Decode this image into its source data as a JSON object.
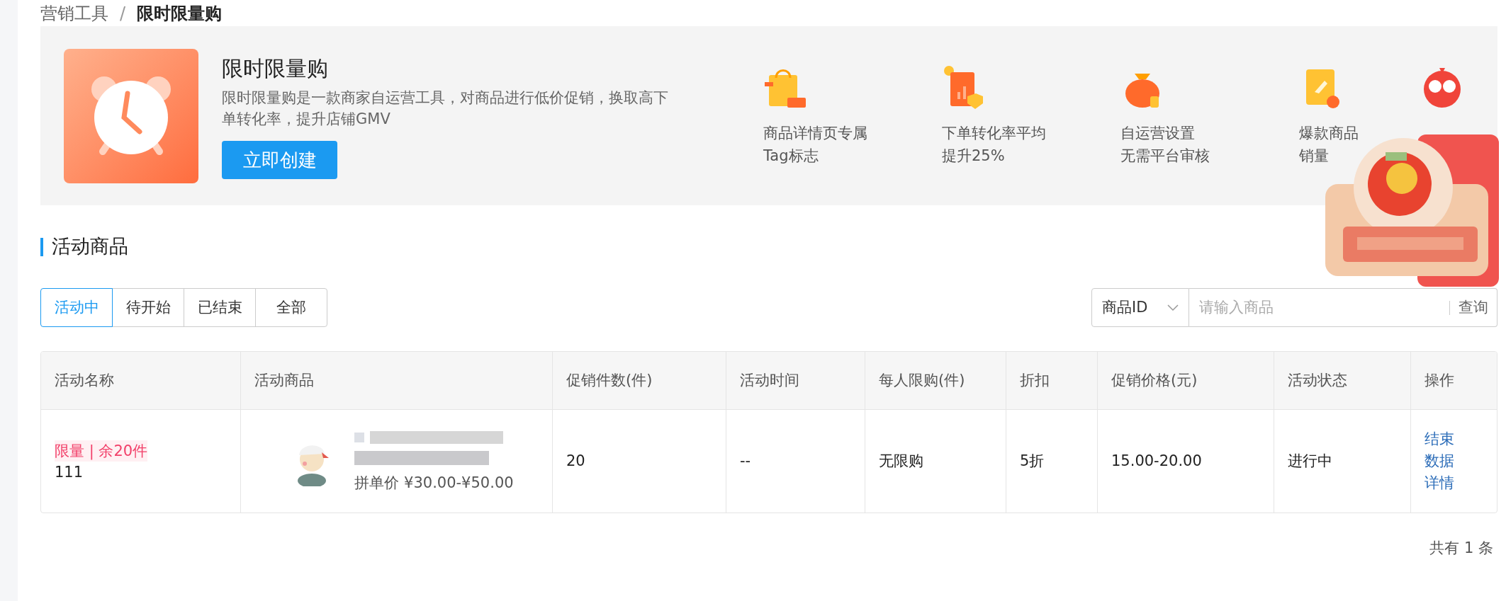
{
  "breadcrumb": {
    "items": [
      {
        "label": "营销工具",
        "current": false
      },
      {
        "label": "限时限量购",
        "current": true
      }
    ],
    "separator": "/"
  },
  "banner": {
    "title": "限时限量购",
    "description": "限时限量购是一款商家自运营工具，对商品进行低价促销，换取高下单转化率，提升店铺GMV",
    "button": "立即创建",
    "features": [
      {
        "kind": "bag",
        "lines": [
          "商品详情页专属",
          "Tag标志"
        ]
      },
      {
        "kind": "chart",
        "lines": [
          "下单转化率平均",
          "提升25%"
        ]
      },
      {
        "kind": "moneybag",
        "lines": [
          "自运营设置",
          "无需平台审核"
        ]
      },
      {
        "kind": "scroll",
        "lines": [
          "爆款商品",
          "销量"
        ]
      },
      {
        "kind": "mascot"
      }
    ]
  },
  "section_title": "活动商品",
  "tabs": [
    {
      "label": "活动中",
      "selected": true
    },
    {
      "label": "待开始",
      "selected": false
    },
    {
      "label": "已结束",
      "selected": false
    },
    {
      "label": "全部",
      "selected": false
    }
  ],
  "search": {
    "field": "商品ID",
    "placeholder": "请输入商品",
    "button": "查询"
  },
  "table": {
    "columns": [
      "活动名称",
      "活动商品",
      "促销件数(件)",
      "活动时间",
      "每人限购(件)",
      "折扣",
      "促销价格(元)",
      "活动状态",
      "操作"
    ],
    "rows": [
      {
        "tag": "限量 | 余20件",
        "name": "111",
        "product_price": "拼单价 ¥30.00-¥50.00",
        "quantity": "20",
        "time": "--",
        "limit": "无限购",
        "discount": "5折",
        "price": "15.00-20.00",
        "status": "进行中",
        "actions": [
          "结束",
          "数据",
          "详情"
        ]
      }
    ]
  },
  "footer": "共有 1 条"
}
